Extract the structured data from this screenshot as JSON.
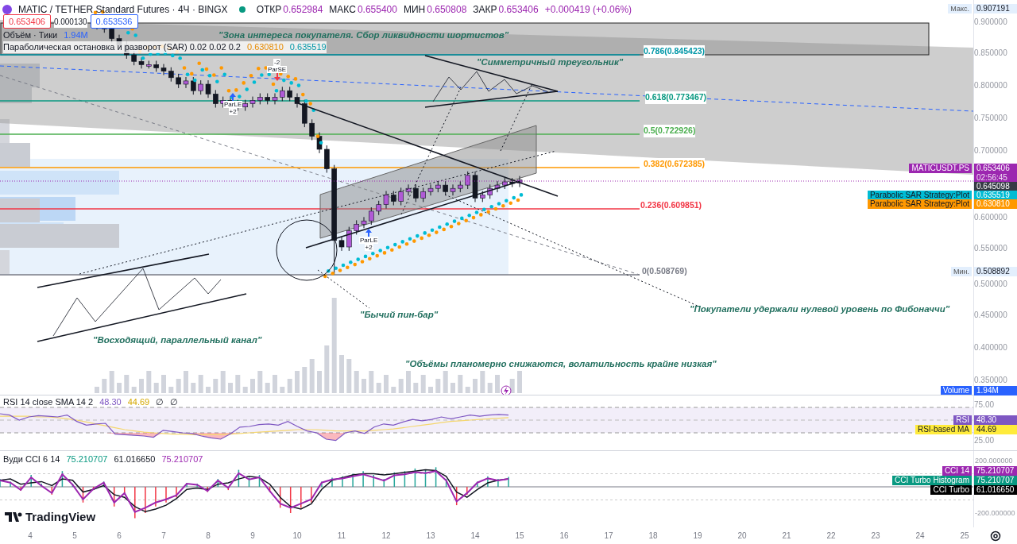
{
  "header": {
    "symbol": "MATIC / TETHER Standard Futures · 4Ч · BINGX",
    "ohlc": [
      {
        "label": "ОТКР",
        "value": "0.652984"
      },
      {
        "label": "МАКС",
        "value": "0.655400"
      },
      {
        "label": "МИН",
        "value": "0.650808"
      },
      {
        "label": "ЗАКР",
        "value": "0.653406"
      }
    ],
    "change": "+0.000419 (+0.06%)"
  },
  "trade": {
    "sell": "0.653406",
    "spread": "0.000130",
    "buy": "0.653536"
  },
  "legends": [
    {
      "name": "Объём · Тики",
      "values": [
        "1.94M"
      ]
    },
    {
      "name": "Параболическая остановка и разворот (SAR) 0.02 0.02 0.2",
      "values": [
        "0.630810",
        "0.635519"
      ]
    }
  ],
  "annotations": [
    "\"Зона интереса покупателя. Сбор ликвидности шортистов\"",
    "\"Симметричный треугольник\"",
    "\"Бычий пин-бар\"",
    "\"Восходящий, параллельный канал\"",
    "\"Покупатели удержали нулевой уровень по Фибоначчи\"",
    "\"Объёмы планомерно снижаются, волатильность крайне низкая\""
  ],
  "fib_levels": [
    {
      "label": "0.786(0.845423)",
      "color": "#0097a7"
    },
    {
      "label": "0.618(0.773467)",
      "color": "#089981"
    },
    {
      "label": "0.5(0.722926)",
      "color": "#4caf50"
    },
    {
      "label": "0.382(0.672385)",
      "color": "#ff9800"
    },
    {
      "label": "0.236(0.609851)",
      "color": "#f23645"
    },
    {
      "label": "0(0.508769)",
      "color": "#787b86"
    }
  ],
  "signals": [
    {
      "kind": "short",
      "label": "ParSE",
      "value": "-2"
    },
    {
      "kind": "long",
      "label": "ParLE",
      "value": "+2"
    },
    {
      "kind": "long",
      "label": "ParLE",
      "value": "+2"
    }
  ],
  "price_axis": {
    "ticks": [
      "0.900000",
      "0.850000",
      "0.800000",
      "0.750000",
      "0.700000",
      "0.600000",
      "0.550000",
      "0.500000",
      "0.450000",
      "0.400000",
      "0.350000"
    ],
    "badges": [
      {
        "kind": "extreme",
        "label": "Макс.",
        "value": "0.907191"
      },
      {
        "kind": "price",
        "label": "MATICUSDT.PS",
        "value": "0.653406",
        "timer": "02:56:45",
        "color": "#9c27b0"
      },
      {
        "kind": "plain",
        "value": "0.645098",
        "color": "#363a45"
      },
      {
        "kind": "price",
        "label": "Parabolic SAR Strategy:Plot",
        "value": "0.635519",
        "color": "#00bcd4"
      },
      {
        "kind": "price",
        "label": "Parabolic SAR Strategy:Plot",
        "value": "0.630810",
        "color": "#ff9800"
      },
      {
        "kind": "extreme",
        "label": "Мин.",
        "value": "0.508892"
      },
      {
        "kind": "price",
        "label": "Volume",
        "value": "1.94M",
        "color": "#2962ff"
      }
    ]
  },
  "rsi": {
    "legend": "RSI 14 close SMA 14 2",
    "values": [
      "48.30",
      "44.69",
      "∅",
      "∅"
    ],
    "ticks": [
      "75.00",
      "25.00"
    ],
    "badges": [
      {
        "label": "RSI",
        "value": "48.30",
        "color": "#7e57c2"
      },
      {
        "label": "RSI-based MA",
        "value": "44.69",
        "color": "#ffeb3b"
      }
    ]
  },
  "cci": {
    "legend": "Вуди CCI 6 14",
    "values": [
      "75.210707",
      "61.016650",
      "75.210707"
    ],
    "ticks": [
      "200.000000",
      "-200.000000"
    ],
    "badges": [
      {
        "label": "CCI 14",
        "value": "75.210707",
        "color": "#9c27b0"
      },
      {
        "label": "CCI Turbo Histogram",
        "value": "75.210707",
        "color": "#089981"
      },
      {
        "label": "CCI Turbo",
        "value": "61.016650",
        "color": "#000000"
      }
    ]
  },
  "time_axis": [
    "4",
    "5",
    "6",
    "7",
    "8",
    "9",
    "10",
    "11",
    "12",
    "13",
    "14",
    "15",
    "16",
    "17",
    "18",
    "19",
    "20",
    "21",
    "22",
    "23",
    "24",
    "25"
  ],
  "logo": "TradingView"
}
